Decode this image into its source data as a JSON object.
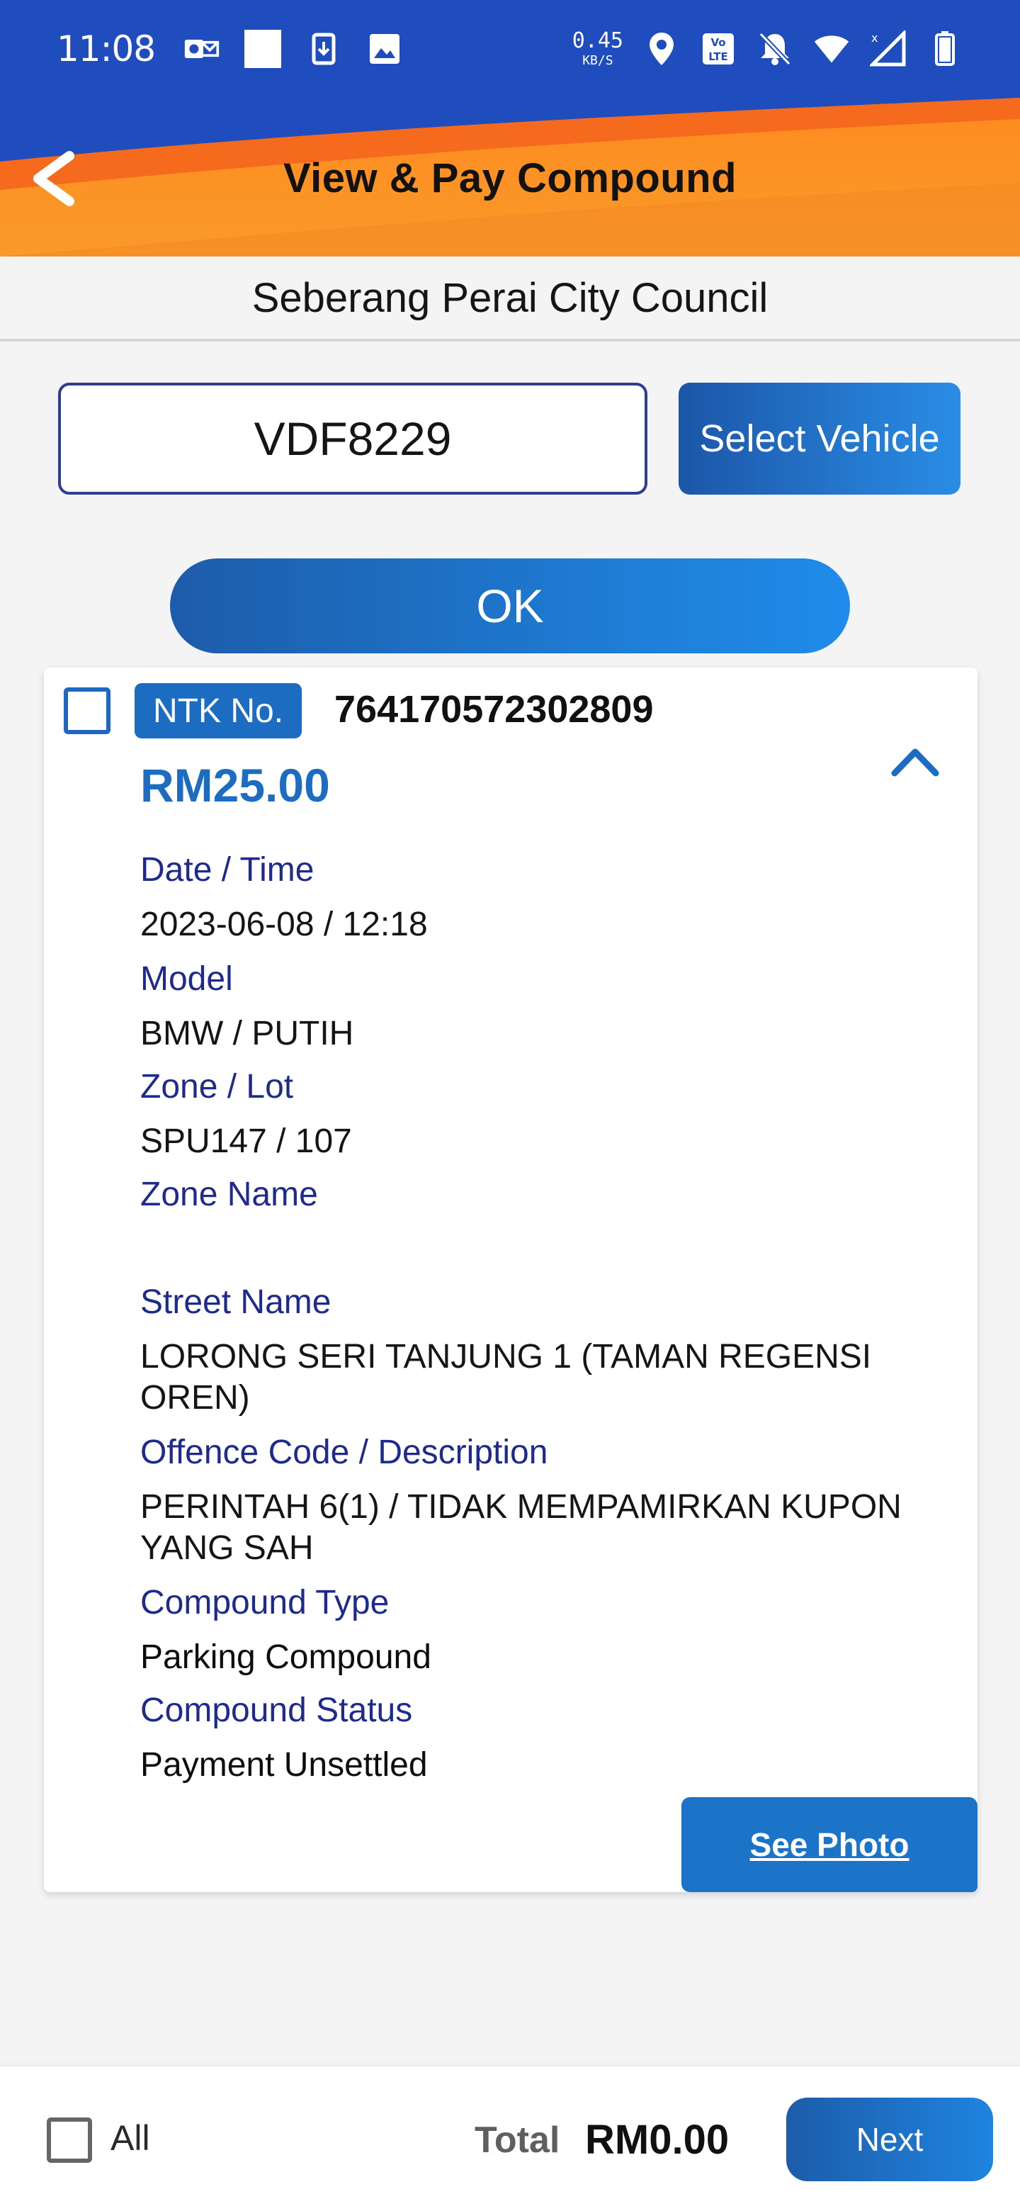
{
  "status_bar": {
    "time": "11:08",
    "net_speed_value": "0.45",
    "net_speed_unit": "KB/S"
  },
  "header": {
    "title": "View & Pay Compound",
    "back_icon": "chevron-left-icon"
  },
  "council": {
    "name": "Seberang Perai City Council"
  },
  "search": {
    "plate_value": "VDF8229",
    "select_vehicle_label": "Select Vehicle",
    "ok_label": "OK"
  },
  "compound": {
    "ntk_label": "NTK No.",
    "ntk_number": "764170572302809",
    "amount": "RM25.00",
    "fields": [
      {
        "label": "Date / Time",
        "value": "2023-06-08 / 12:18"
      },
      {
        "label": "Model",
        "value": "BMW / PUTIH"
      },
      {
        "label": "Zone / Lot",
        "value": "SPU147 / 107"
      },
      {
        "label": "Zone Name",
        "value": ""
      },
      {
        "label": "Street Name",
        "value": "LORONG SERI TANJUNG 1 (TAMAN REGENSI OREN)"
      },
      {
        "label": "Offence Code / Description",
        "value": "PERINTAH 6(1) / TIDAK MEMPAMIRKAN KUPON YANG SAH"
      },
      {
        "label": "Compound Type",
        "value": "Parking Compound"
      },
      {
        "label": "Compound Status",
        "value": "Payment Unsettled"
      }
    ],
    "see_photo_label": "See Photo"
  },
  "footer": {
    "all_label": "All",
    "total_label": "Total",
    "total_value": "RM0.00",
    "next_label": "Next"
  },
  "colors": {
    "status_bar": "#1f4dbd",
    "header_orange": "#f99a2a",
    "accent_blue": "#1c6dc2",
    "label_navy": "#1f2b8c"
  }
}
